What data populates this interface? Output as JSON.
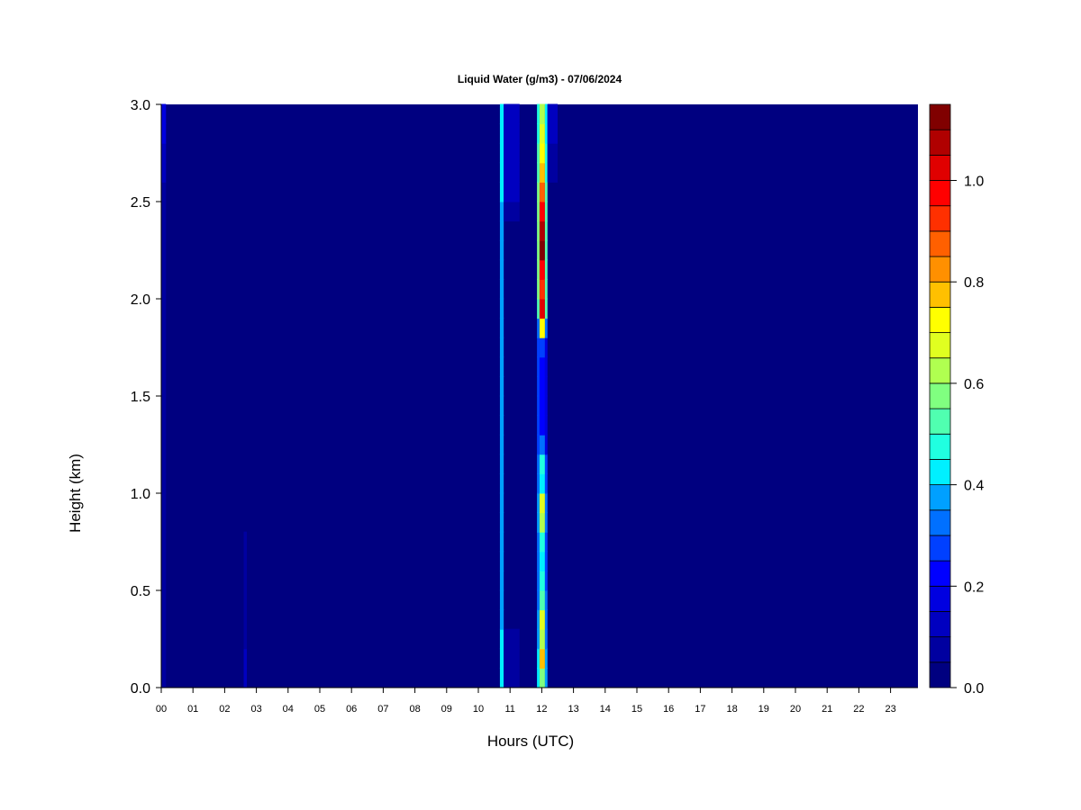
{
  "chart_data": {
    "type": "heatmap",
    "title": "Liquid Water (g/m3) - 07/06/2024",
    "xlabel": "Hours (UTC)",
    "ylabel": "Height (km)",
    "xlim": [
      0,
      23.87
    ],
    "ylim": [
      0,
      3.0
    ],
    "x_tick_labels": [
      "00",
      "01",
      "02",
      "03",
      "04",
      "05",
      "06",
      "07",
      "08",
      "09",
      "10",
      "11",
      "12",
      "13",
      "14",
      "15",
      "16",
      "17",
      "18",
      "19",
      "20",
      "21",
      "22",
      "23"
    ],
    "y_tick_labels": [
      "0.0",
      "0.5",
      "1.0",
      "1.5",
      "2.0",
      "2.5",
      "3.0"
    ],
    "y_ticks": [
      0,
      0.5,
      1.0,
      1.5,
      2.0,
      2.5,
      3.0
    ],
    "colorbar": {
      "levels_step": 0.05,
      "range": [
        0,
        1.15
      ],
      "tick_labels": [
        "0.0",
        "0.2",
        "0.4",
        "0.6",
        "0.8",
        "1.0"
      ],
      "ticks": [
        0,
        0.2,
        0.4,
        0.6,
        0.8,
        1.0
      ],
      "colors": [
        "#000080",
        "#0000a0",
        "#0000c0",
        "#0000e0",
        "#0000ff",
        "#0040ff",
        "#0070ff",
        "#00a0ff",
        "#00f0ff",
        "#20ffe0",
        "#50ffb0",
        "#80ff80",
        "#b0ff50",
        "#e0ff20",
        "#ffff00",
        "#ffc000",
        "#ff9000",
        "#ff6000",
        "#ff3000",
        "#ff0000",
        "#e00000",
        "#b00000",
        "#800000"
      ]
    },
    "background_value": 0.0,
    "heights": [
      0.05,
      0.15,
      0.25,
      0.35,
      0.45,
      0.55,
      0.65,
      0.75,
      0.85,
      0.95,
      1.05,
      1.15,
      1.25,
      1.35,
      1.45,
      1.55,
      1.65,
      1.75,
      1.85,
      1.95,
      2.05,
      2.15,
      2.25,
      2.35,
      2.45,
      2.55,
      2.65,
      2.75,
      2.85,
      2.95
    ],
    "columns": [
      {
        "x0": 0.0,
        "x1": 0.15,
        "values": [
          0.05,
          0.05,
          0.05,
          0.05,
          0.05,
          0.05,
          0.05,
          0.05,
          0.05,
          0.05,
          0.05,
          0.05,
          0.05,
          0.05,
          0.05,
          0.05,
          0.05,
          0.05,
          0.05,
          0.05,
          0.05,
          0.05,
          0.05,
          0.05,
          0.05,
          0.05,
          0.1,
          0.1,
          0.15,
          0.15
        ]
      },
      {
        "x0": 2.6,
        "x1": 2.7,
        "values": [
          0.1,
          0.1,
          0.05,
          0.05,
          0.05,
          0.05,
          0.05,
          0.05,
          0,
          0,
          0,
          0,
          0,
          0,
          0,
          0,
          0,
          0,
          0,
          0,
          0,
          0,
          0,
          0,
          0,
          0,
          0,
          0,
          0,
          0
        ]
      },
      {
        "x0": 10.68,
        "x1": 10.8,
        "values": [
          0.4,
          0.4,
          0.4,
          0.35,
          0.35,
          0.35,
          0.35,
          0.35,
          0.35,
          0.35,
          0.35,
          0.35,
          0.35,
          0.35,
          0.35,
          0.35,
          0.35,
          0.35,
          0.35,
          0.35,
          0.35,
          0.35,
          0.35,
          0.35,
          0.35,
          0.4,
          0.4,
          0.4,
          0.4,
          0.4
        ]
      },
      {
        "x0": 10.8,
        "x1": 11.3,
        "values": [
          0.05,
          0.05,
          0.05,
          0,
          0,
          0,
          0,
          0,
          0,
          0,
          0,
          0,
          0,
          0,
          0,
          0,
          0,
          0,
          0,
          0,
          0,
          0,
          0,
          0,
          0.05,
          0.1,
          0.1,
          0.1,
          0.1,
          0.1
        ]
      },
      {
        "x0": 11.85,
        "x1": 11.93,
        "values": [
          0.4,
          0.4,
          0.35,
          0.35,
          0.3,
          0.3,
          0.3,
          0.3,
          0.35,
          0.35,
          0.3,
          0.3,
          0.25,
          0.25,
          0.25,
          0.25,
          0.25,
          0.25,
          0.3,
          0.5,
          0.55,
          0.55,
          0.55,
          0.55,
          0.55,
          0.55,
          0.5,
          0.5,
          0.45,
          0.45
        ]
      },
      {
        "x0": 11.93,
        "x1": 12.1,
        "values": [
          0.55,
          0.75,
          0.6,
          0.65,
          0.5,
          0.45,
          0.4,
          0.45,
          0.6,
          0.65,
          0.4,
          0.45,
          0.3,
          0.2,
          0.2,
          0.2,
          0.2,
          0.25,
          0.7,
          1.0,
          0.9,
          0.95,
          1.1,
          1.05,
          0.95,
          0.85,
          0.75,
          0.7,
          0.65,
          0.6
        ]
      },
      {
        "x0": 12.1,
        "x1": 12.18,
        "values": [
          0.35,
          0.35,
          0.3,
          0.3,
          0.3,
          0.25,
          0.25,
          0.25,
          0.3,
          0.3,
          0.25,
          0.25,
          0.15,
          0.15,
          0.15,
          0.15,
          0.15,
          0.15,
          0.3,
          0.5,
          0.5,
          0.5,
          0.5,
          0.5,
          0.5,
          0.5,
          0.45,
          0.45,
          0.4,
          0.4
        ]
      },
      {
        "x0": 12.18,
        "x1": 12.5,
        "values": [
          0,
          0,
          0,
          0,
          0,
          0,
          0,
          0,
          0,
          0,
          0,
          0,
          0,
          0,
          0,
          0,
          0,
          0,
          0,
          0,
          0,
          0,
          0,
          0,
          0,
          0,
          0.05,
          0.05,
          0.1,
          0.1
        ]
      }
    ]
  }
}
